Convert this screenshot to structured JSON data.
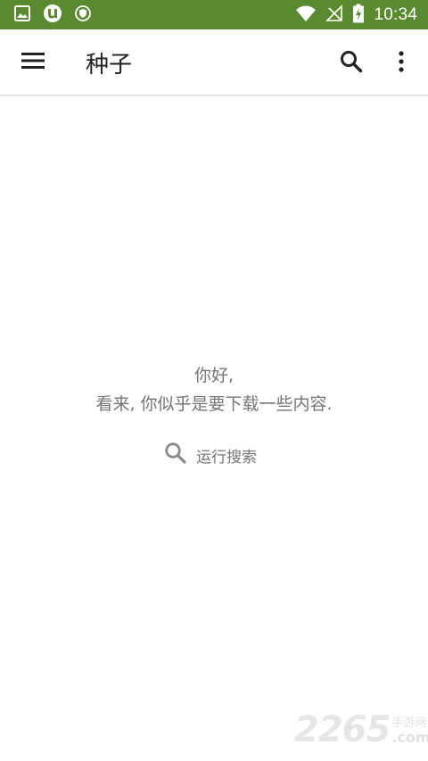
{
  "status_bar": {
    "time": "10:34",
    "icons": [
      "gallery-icon",
      "utorrent-icon",
      "shield-icon",
      "wifi-icon",
      "no-signal-icon",
      "battery-charging-icon"
    ],
    "background_color": "#5a8a2f"
  },
  "app_bar": {
    "title": "种子",
    "icons": [
      "menu-icon",
      "search-icon",
      "more-vert-icon"
    ]
  },
  "empty_state": {
    "greeting": "你好,",
    "message": "看来, 你似乎是要下载一些内容.",
    "action_label": "运行搜索",
    "action_icon": "search-icon"
  },
  "watermark": {
    "digits": "2265",
    "site_name": "手游网",
    "suffix": ".com"
  }
}
